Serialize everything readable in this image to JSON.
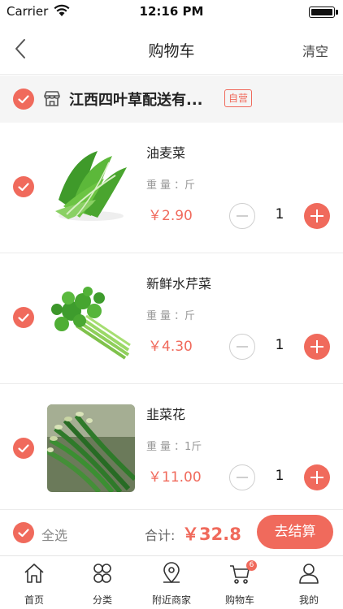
{
  "status_bar": {
    "carrier": "Carrier",
    "time": "12:16 PM"
  },
  "nav": {
    "title": "购物车",
    "clear_label": "清空",
    "back_icon": "chevron-left-icon"
  },
  "shop": {
    "name": "江西四叶草配送有...",
    "badge": "自营",
    "icon": "store-icon"
  },
  "items": [
    {
      "name": "油麦菜",
      "spec_label": "重量",
      "spec_value": "：斤",
      "price": "￥2.90",
      "quantity": "1",
      "image": "lettuce-image"
    },
    {
      "name": "新鲜水芹菜",
      "spec_label": "重量",
      "spec_value": "：斤",
      "price": "￥4.30",
      "quantity": "1",
      "image": "celery-image"
    },
    {
      "name": "韭菜花",
      "spec_label": "重量",
      "spec_value": "：1斤",
      "price": "￥11.00",
      "quantity": "1",
      "image": "chive-flower-image"
    }
  ],
  "checkout": {
    "select_all_label": "全选",
    "total_label": "合计:",
    "total_value": "￥32.8",
    "button_label": "去结算"
  },
  "tabs": [
    {
      "label": "首页",
      "icon": "home-icon"
    },
    {
      "label": "分类",
      "icon": "category-icon"
    },
    {
      "label": "附近商家",
      "icon": "location-icon"
    },
    {
      "label": "购物车",
      "icon": "cart-icon",
      "badge": "6"
    },
    {
      "label": "我的",
      "icon": "profile-icon"
    }
  ],
  "colors": {
    "accent": "#f06a5c",
    "muted": "#999999",
    "divider": "#ececec",
    "shop_bg": "#f5f5f5"
  }
}
